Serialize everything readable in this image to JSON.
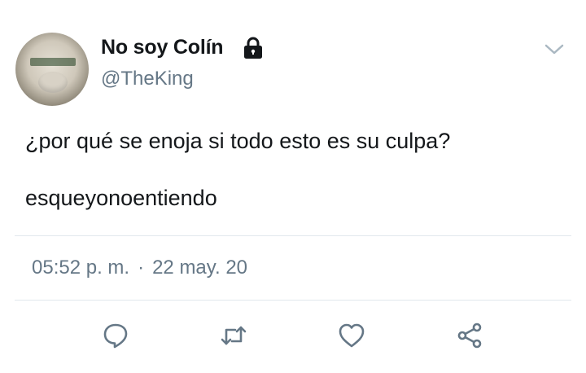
{
  "tweet": {
    "display_name": "No soy Colín",
    "handle": "@TheKing",
    "lines": [
      "¿por qué se enoja si todo esto es su culpa?",
      "esqueyonoentiendo"
    ],
    "time": "05:52 p. m.",
    "separator": "·",
    "date": "22 may. 20"
  },
  "icons": {
    "lock": "lock-icon",
    "menu": "chevron-down-icon",
    "reply": "reply-icon",
    "retweet": "retweet-icon",
    "like": "heart-icon",
    "share": "share-icon"
  },
  "colors": {
    "text": "#14171a",
    "secondary": "#657786",
    "icon": "#657786",
    "divider": "#e1e8ed"
  }
}
